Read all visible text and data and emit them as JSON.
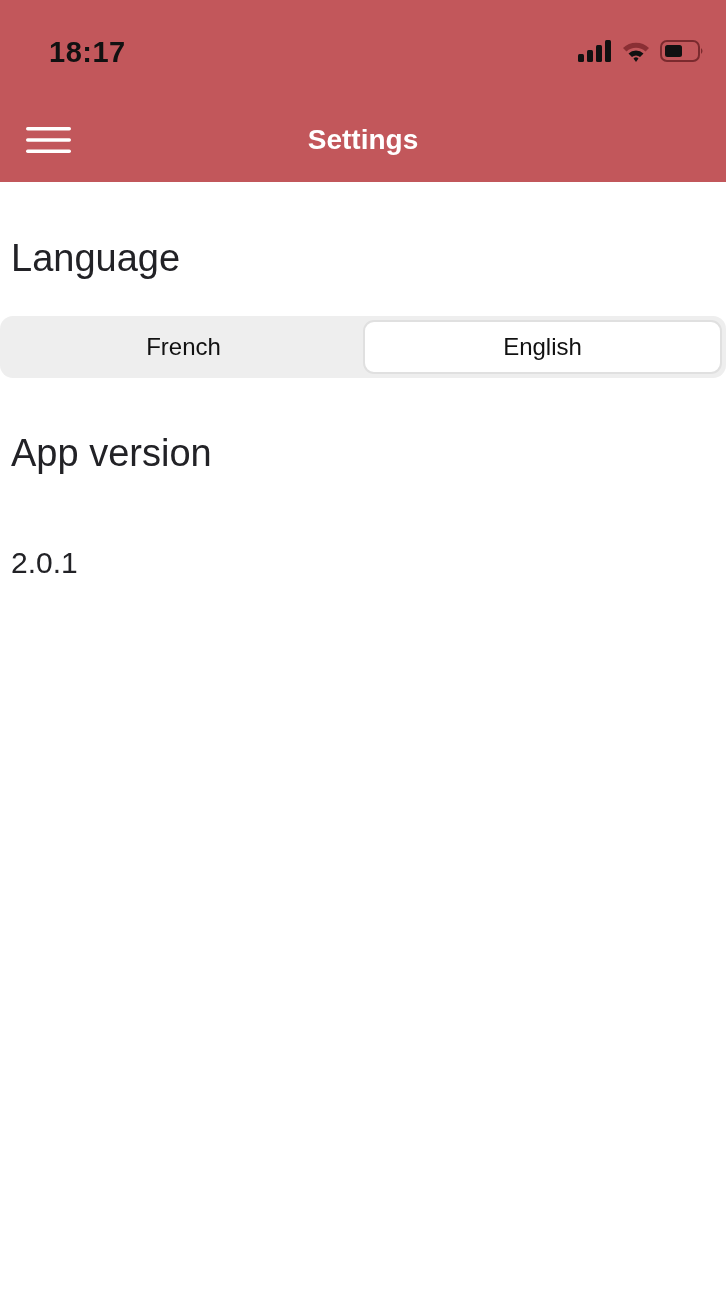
{
  "status_bar": {
    "time": "18:17"
  },
  "header": {
    "title": "Settings"
  },
  "language": {
    "title": "Language",
    "options": [
      {
        "label": "French",
        "selected": false
      },
      {
        "label": "English",
        "selected": true
      }
    ]
  },
  "app_version": {
    "title": "App version",
    "value": "2.0.1"
  }
}
